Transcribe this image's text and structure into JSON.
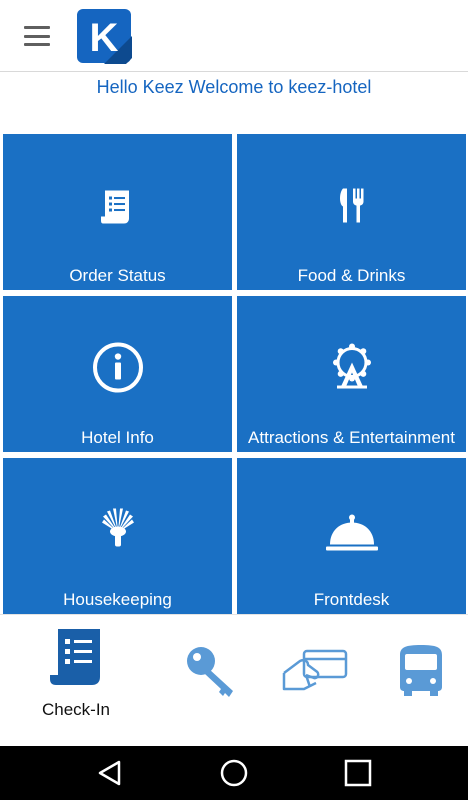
{
  "header": {
    "menu_icon": "hamburger-menu-icon",
    "logo_letter": "K",
    "welcome_text": "Hello Keez Welcome to keez-hotel"
  },
  "tiles": [
    {
      "label": "Order Status",
      "icon": "receipt-icon"
    },
    {
      "label": "Food & Drinks",
      "icon": "fork-knife-icon"
    },
    {
      "label": "Hotel Info",
      "icon": "info-icon"
    },
    {
      "label": "Attractions & Entertainment",
      "icon": "ferris-wheel-icon"
    },
    {
      "label": "Housekeeping",
      "icon": "feather-duster-icon"
    },
    {
      "label": "Frontdesk",
      "icon": "service-bell-icon"
    }
  ],
  "bottom_nav": {
    "checkin_label": "Check-In",
    "icons": [
      "receipt-icon",
      "key-icon",
      "card-payment-icon",
      "bus-icon"
    ]
  },
  "colors": {
    "tile": "#1a70c4",
    "accent": "#1565c0",
    "nav_dark": "#1a5fa8",
    "nav_light": "#5a9ad6"
  },
  "system_nav": [
    "back-icon",
    "home-icon",
    "recents-icon"
  ]
}
